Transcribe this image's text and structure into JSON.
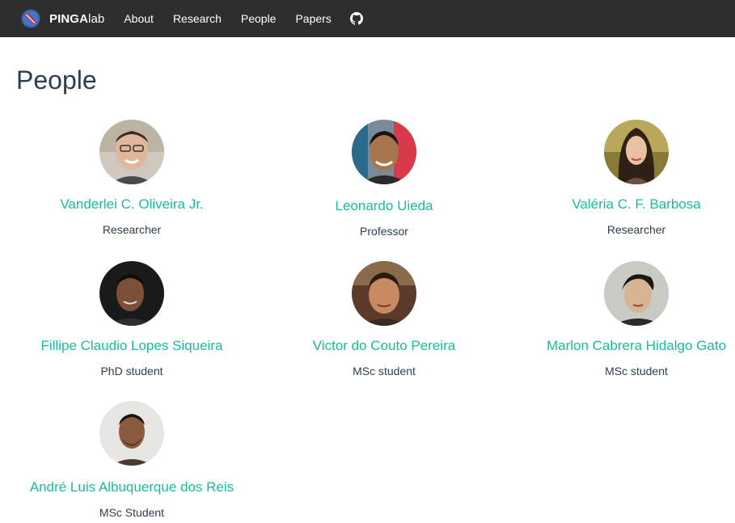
{
  "navbar": {
    "brand_bold": "PINGA",
    "brand_light": "lab",
    "links": [
      "About",
      "Research",
      "People",
      "Papers"
    ],
    "github_icon": "github-icon"
  },
  "page": {
    "title": "People"
  },
  "people": [
    {
      "name": "Vanderlei C. Oliveira Jr.",
      "role": "Researcher"
    },
    {
      "name": "Leonardo Uieda",
      "role": "Professor"
    },
    {
      "name": "Valéria C. F. Barbosa",
      "role": "Researcher"
    },
    {
      "name": "Fillipe Claudio Lopes Siqueira",
      "role": "PhD student"
    },
    {
      "name": "Victor do Couto Pereira",
      "role": "MSc student"
    },
    {
      "name": "Marlon Cabrera Hidalgo Gato",
      "role": "MSc student"
    },
    {
      "name": "André Luis Albuquerque dos Reis",
      "role": "MSc Student"
    }
  ],
  "colors": {
    "navbar": "#2e2e2e",
    "link": "#18bc9c",
    "text": "#2c3e50"
  }
}
